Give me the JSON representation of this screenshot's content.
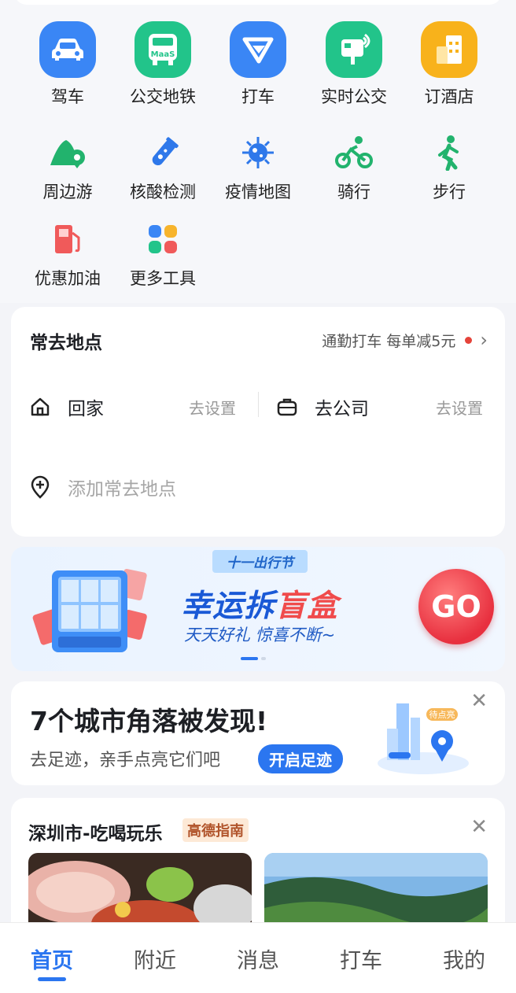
{
  "tools": [
    {
      "label": "驾车",
      "icon": "car-icon",
      "color": "#3a86f5"
    },
    {
      "label": "公交地铁",
      "icon": "bus-icon",
      "color": "#22c48a"
    },
    {
      "label": "打车",
      "icon": "taxi-icon",
      "color": "#3a86f5"
    },
    {
      "label": "实时公交",
      "icon": "realtime-bus-icon",
      "color": "#22c48a"
    },
    {
      "label": "订酒店",
      "icon": "hotel-icon",
      "color": "#f8b21b"
    },
    {
      "label": "周边游",
      "icon": "nearby-travel-icon",
      "color": "#22b36d"
    },
    {
      "label": "核酸检测",
      "icon": "test-tube-icon",
      "color": "#2e78ea"
    },
    {
      "label": "疫情地图",
      "icon": "virus-icon",
      "color": "#2e78ea"
    },
    {
      "label": "骑行",
      "icon": "cycling-icon",
      "color": "#22b36d"
    },
    {
      "label": "步行",
      "icon": "walking-icon",
      "color": "#22b36d"
    },
    {
      "label": "优惠加油",
      "icon": "fuel-icon",
      "color": "#f05a5a"
    },
    {
      "label": "更多工具",
      "icon": "more-tools-icon",
      "color": "#3a86f5"
    }
  ],
  "bus_badge": "MaaS",
  "places": {
    "title": "常去地点",
    "promo": "通勤打车 每单减5元",
    "home": {
      "label": "回家",
      "action": "去设置"
    },
    "work": {
      "label": "去公司",
      "action": "去设置"
    },
    "add_label": "添加常去地点"
  },
  "banner": {
    "tag": "十一出行节",
    "headline_a": "幸运拆",
    "headline_b": "盲盒",
    "subline": "天天好礼  惊喜不断~",
    "go_label": "GO"
  },
  "footprint": {
    "title": "7个城市角落被发现!",
    "desc": "去足迹，亲手点亮它们吧",
    "button": "开启足迹",
    "pin_label": "待点亮"
  },
  "guide": {
    "title": "深圳市-吃喝玩乐",
    "badge": "高德指南"
  },
  "tabs": [
    {
      "label": "首页",
      "active": true
    },
    {
      "label": "附近",
      "active": false
    },
    {
      "label": "消息",
      "active": false
    },
    {
      "label": "打车",
      "active": false
    },
    {
      "label": "我的",
      "active": false
    }
  ],
  "colors": {
    "accent": "#2b76f0",
    "promo_dot": "#e5433a"
  }
}
